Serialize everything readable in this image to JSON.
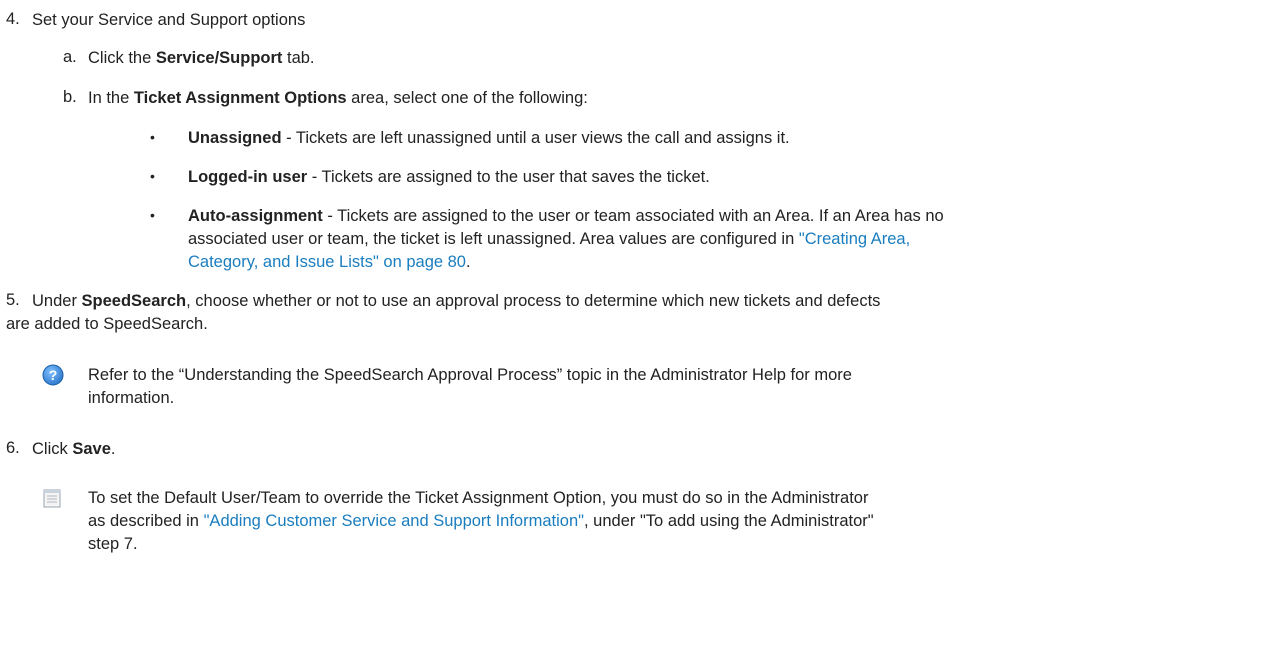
{
  "step4": {
    "num": "4.",
    "text": "Set your Service and Support options",
    "a": {
      "letter": "a.",
      "pre": "Click the ",
      "bold": "Service/Support",
      "post": " tab."
    },
    "b": {
      "letter": "b.",
      "pre": "In the ",
      "bold": "Ticket Assignment Options",
      "post": " area, select one of the following:"
    },
    "bullets": [
      {
        "bold": "Unassigned",
        "text": " - Tickets are left unassigned until a user views the call and assigns it."
      },
      {
        "bold": "Logged-in user",
        "text": " - Tickets are assigned to the user that saves the ticket."
      },
      {
        "bold": "Auto-assignment",
        "text": " - Tickets are assigned to the user or team associated with an Area. If an Area has no",
        "line2_pre": "associated user or team, the ticket is left unassigned. Area values are configured in ",
        "link_part1": "\"Creating Area,",
        "link_part2": "Category, and Issue Lists\" on page 80",
        "line3_post": "."
      }
    ]
  },
  "step5": {
    "num": "5.",
    "pre": "Under ",
    "bold": "SpeedSearch",
    "post": ", choose whether or not to use an approval process to determine which new tickets and defects",
    "line2": "are added to SpeedSearch.",
    "help_line1": "Refer to the “Understanding the SpeedSearch Approval Process” topic in the Administrator Help for more",
    "help_line2": "information."
  },
  "step6": {
    "num": "6.",
    "pre": "Click ",
    "bold": "Save",
    "post": ".",
    "note_line1": "To set the Default User/Team to override the Ticket Assignment Option, you must do so in the Administrator",
    "note_line2_pre": "as described in ",
    "note_link": "\"Adding Customer Service and Support Information\"",
    "note_line2_post": ", under \"To add using the Administrator\"",
    "note_line3": "step 7."
  },
  "icons": {
    "help": "help-icon",
    "note": "note-icon",
    "bullet": "bullet-dot"
  },
  "colors": {
    "link": "#1a7dbf",
    "help_icon": "#3d8ed8",
    "text": "#222222"
  }
}
